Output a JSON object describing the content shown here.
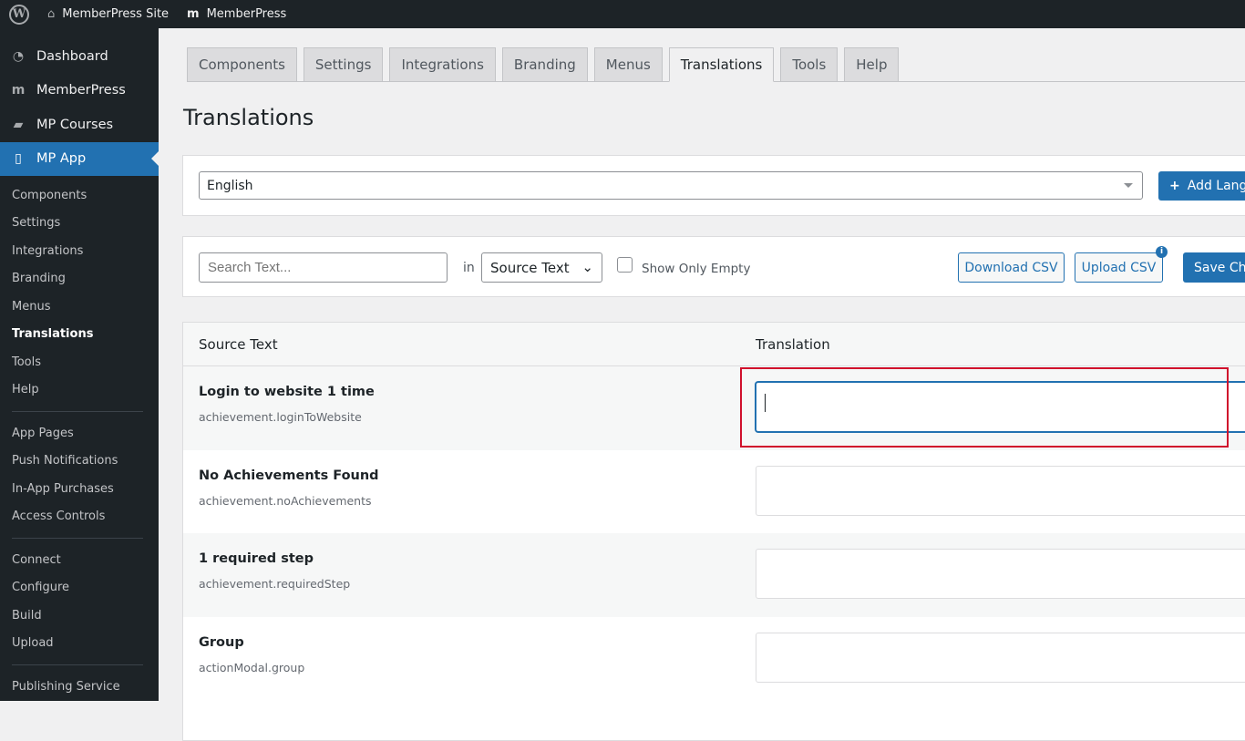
{
  "topbar": {
    "site": "MemberPress Site",
    "plugin": "MemberPress"
  },
  "sidebar": {
    "menus": [
      {
        "label": "Dashboard",
        "icon": "dashboard-icon"
      },
      {
        "label": "MemberPress",
        "icon": "memberpress-icon"
      },
      {
        "label": "MP Courses",
        "icon": "courses-icon"
      },
      {
        "label": "MP App",
        "icon": "app-icon"
      }
    ],
    "group1": [
      "Components",
      "Settings",
      "Integrations",
      "Branding",
      "Menus",
      "Translations",
      "Tools",
      "Help"
    ],
    "group2": [
      "App Pages",
      "Push Notifications",
      "In-App Purchases",
      "Access Controls"
    ],
    "group3": [
      "Connect",
      "Configure",
      "Build",
      "Upload"
    ],
    "group4": [
      "Publishing Service"
    ]
  },
  "tabs": [
    "Components",
    "Settings",
    "Integrations",
    "Branding",
    "Menus",
    "Translations",
    "Tools",
    "Help"
  ],
  "title": "Translations",
  "language": {
    "selected": "English",
    "add_label": "Add Language"
  },
  "toolbar": {
    "search_placeholder": "Search Text...",
    "in_label": "in",
    "field_select": "Source Text",
    "show_empty": "Show Only Empty",
    "download": "Download CSV",
    "upload": "Upload CSV",
    "save": "Save Changes"
  },
  "table": {
    "headers": [
      "Source Text",
      "Translation"
    ],
    "rows": [
      {
        "text": "Login to website 1 time",
        "key": "achievement.loginToWebsite",
        "value": ""
      },
      {
        "text": "No Achievements Found",
        "key": "achievement.noAchievements",
        "value": ""
      },
      {
        "text": "1 required step",
        "key": "achievement.requiredStep",
        "value": ""
      },
      {
        "text": "Group",
        "key": "actionModal.group",
        "value": ""
      }
    ]
  },
  "colors": {
    "accent": "#2271b1",
    "highlight": "#d0102c"
  }
}
